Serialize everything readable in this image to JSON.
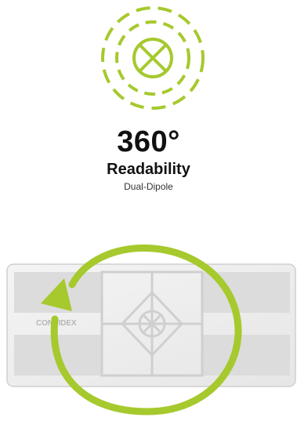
{
  "icon": {
    "name": "rotation-cross-icon",
    "color": "#a6c92e"
  },
  "headline": {
    "degrees": "360°",
    "title": "Readability",
    "subtitle": "Dual-Dipole"
  },
  "tag": {
    "brand_text": "CONFIDEX",
    "arrow_color": "#a6c92e",
    "arrow_icon": "circular-arrow-icon"
  }
}
